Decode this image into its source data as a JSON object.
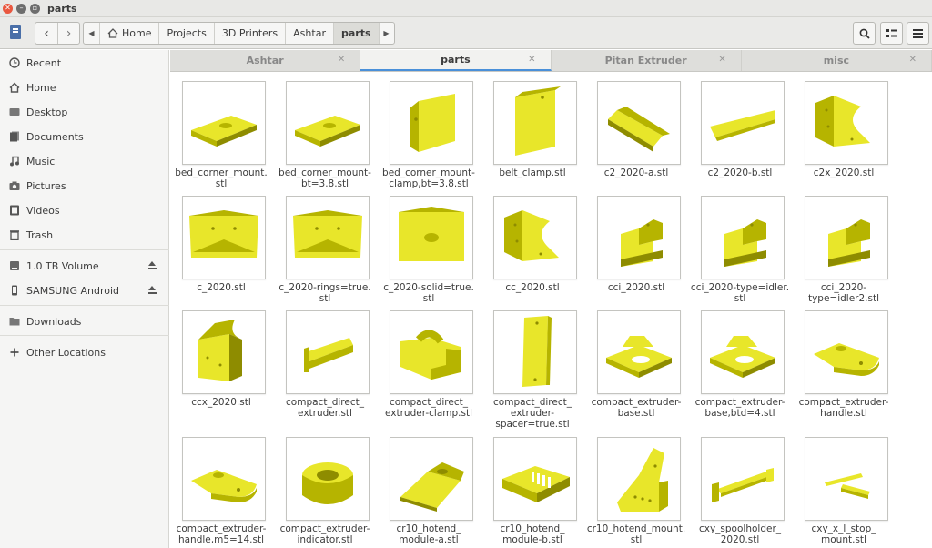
{
  "window": {
    "title": "parts"
  },
  "breadcrumbs": [
    "Home",
    "Projects",
    "3D Printers",
    "Ashtar",
    "parts"
  ],
  "sidebar": {
    "items": [
      {
        "label": "Recent",
        "icon": "clock-icon"
      },
      {
        "label": "Home",
        "icon": "home-icon"
      },
      {
        "label": "Desktop",
        "icon": "desktop-icon"
      },
      {
        "label": "Documents",
        "icon": "documents-icon"
      },
      {
        "label": "Music",
        "icon": "music-icon"
      },
      {
        "label": "Pictures",
        "icon": "camera-icon"
      },
      {
        "label": "Videos",
        "icon": "video-icon"
      },
      {
        "label": "Trash",
        "icon": "trash-icon"
      }
    ],
    "devices": [
      {
        "label": "1.0 TB Volume",
        "icon": "drive-icon"
      },
      {
        "label": "SAMSUNG Android",
        "icon": "phone-icon"
      }
    ],
    "other": [
      {
        "label": "Downloads",
        "icon": "folder-icon"
      },
      {
        "label": "Other Locations",
        "icon": "plus-icon"
      }
    ]
  },
  "tabs": [
    {
      "label": "Ashtar",
      "active": false
    },
    {
      "label": "parts",
      "active": true
    },
    {
      "label": "Pitan Extruder",
      "active": false
    },
    {
      "label": "misc",
      "active": false
    }
  ],
  "files": [
    {
      "name": "bed_corner_mount.\nstl",
      "shape": "plate"
    },
    {
      "name": "bed_corner_mount-\nbt=3.8.stl",
      "shape": "plate"
    },
    {
      "name": "bed_corner_mount-\nclamp,bt=3.8.stl",
      "shape": "clamp"
    },
    {
      "name": "belt_clamp.stl",
      "shape": "block"
    },
    {
      "name": "c2_2020-a.stl",
      "shape": "wedge"
    },
    {
      "name": "c2_2020-b.stl",
      "shape": "flat-wedge"
    },
    {
      "name": "c2x_2020.stl",
      "shape": "bracket"
    },
    {
      "name": "c_2020.stl",
      "shape": "face"
    },
    {
      "name": "c_2020-rings=true.\nstl",
      "shape": "face"
    },
    {
      "name": "c_2020-solid=true.\nstl",
      "shape": "face-solid"
    },
    {
      "name": "cc_2020.stl",
      "shape": "bracket"
    },
    {
      "name": "cci_2020.stl",
      "shape": "stair"
    },
    {
      "name": "cci_2020-type=idler.\nstl",
      "shape": "stair"
    },
    {
      "name": "cci_2020-\ntype=idler2.stl",
      "shape": "stair"
    },
    {
      "name": "ccx_2020.stl",
      "shape": "ccx"
    },
    {
      "name": "compact_direct_\nextruder.stl",
      "shape": "bar"
    },
    {
      "name": "compact_direct_\nextruder-clamp.stl",
      "shape": "saddle"
    },
    {
      "name": "compact_direct_\nextruder-\nspacer=true.stl",
      "shape": "tall"
    },
    {
      "name": "compact_extruder-\nbase.stl",
      "shape": "base"
    },
    {
      "name": "compact_extruder-\nbase,btd=4.stl",
      "shape": "base"
    },
    {
      "name": "compact_extruder-\nhandle.stl",
      "shape": "handle"
    },
    {
      "name": "compact_extruder-\nhandle,m5=14.stl",
      "shape": "handle"
    },
    {
      "name": "compact_extruder-\nindicator.stl",
      "shape": "ring"
    },
    {
      "name": "cr10_hotend_\nmodule-a.stl",
      "shape": "module"
    },
    {
      "name": "cr10_hotend_\nmodule-b.stl",
      "shape": "module-b"
    },
    {
      "name": "cr10_hotend_mount.\nstl",
      "shape": "mount"
    },
    {
      "name": "cxy_spoolholder_\n2020.stl",
      "shape": "spool"
    },
    {
      "name": "cxy_x_l_stop_\nmount.stl",
      "shape": "stop"
    }
  ],
  "colors": {
    "part_fill": "#e8e62a",
    "part_shade": "#b6b400",
    "part_dark": "#8e8c00",
    "accent": "#4a90d9"
  }
}
